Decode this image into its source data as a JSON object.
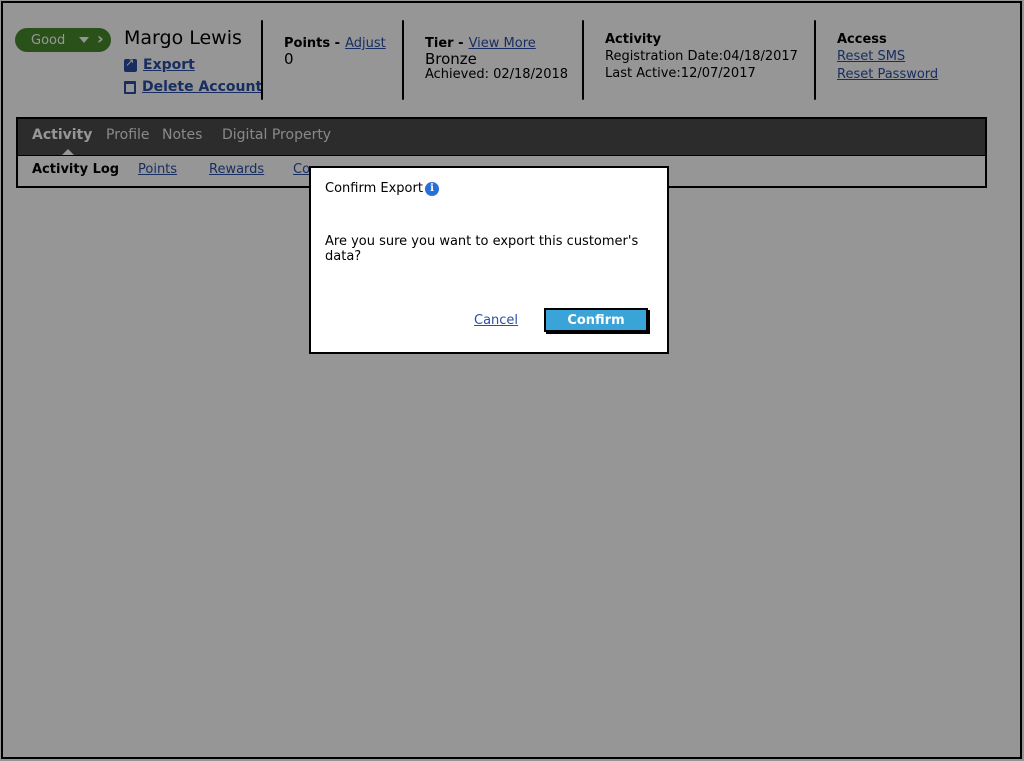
{
  "customer": {
    "status": "Good",
    "name": "Margo Lewis",
    "export_label": "Export",
    "delete_label": "Delete Account"
  },
  "points": {
    "label": "Points -",
    "link": "Adjust",
    "value": "0"
  },
  "tier": {
    "label": "Tier -",
    "link": "View More",
    "value": "Bronze",
    "achieved": "Achieved: 02/18/2018"
  },
  "activity": {
    "label": "Activity",
    "registration": "Registration Date:04/18/2017",
    "last_active": "Last Active:12/07/2017"
  },
  "access": {
    "label": "Access",
    "reset_sms": "Reset SMS",
    "reset_password": "Reset Password"
  },
  "tabs": [
    "Activity",
    "Profile",
    "Notes",
    "Digital Property"
  ],
  "subtabs": [
    "Activity Log",
    "Points",
    "Rewards",
    "Co"
  ],
  "modal": {
    "title": "Confirm Export",
    "message": "Are you sure you want to export this customer's data?",
    "cancel": "Cancel",
    "confirm": "Confirm"
  },
  "colors": {
    "status_green": "#4a8a2e",
    "link_blue": "#2a4ea6",
    "confirm_blue": "#3aa3d8",
    "tabbar": "#4b4b4b"
  }
}
